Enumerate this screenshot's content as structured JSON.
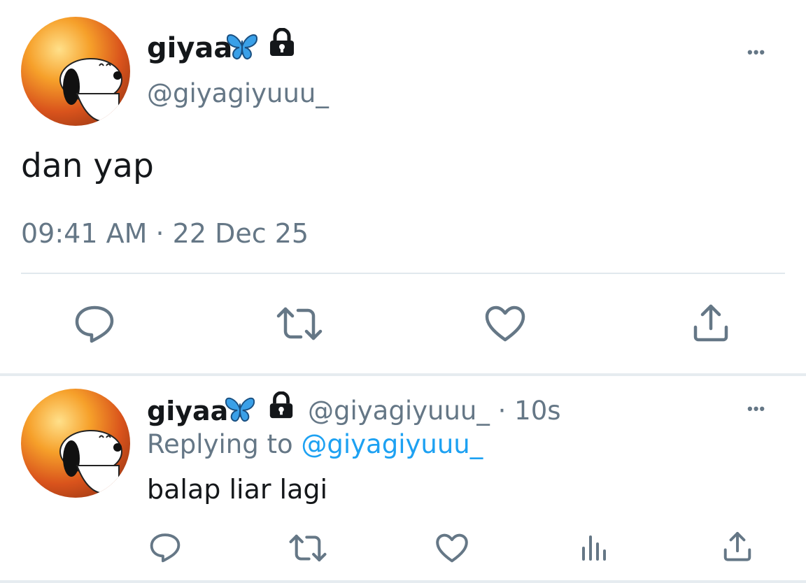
{
  "main_tweet": {
    "display_name": "giyaa",
    "handle": "@giyagiyuuu_",
    "text": "dan yap",
    "timestamp": "09:41 AM",
    "separator": "·",
    "date": "22 Dec 25",
    "more_label": "•••"
  },
  "reply_tweet": {
    "display_name": "giyaa",
    "handle": "@giyagiyuuu_",
    "separator": "·",
    "age": "10s",
    "replying_prefix": "Replying to",
    "replying_handle": "@giyagiyuuu_",
    "text": "balap liar lagi",
    "more_label": "•••"
  },
  "icons": {
    "badge": "butterfly-icon",
    "lock": "lock-icon",
    "reply": "reply-icon",
    "retweet": "retweet-icon",
    "like": "heart-icon",
    "share": "share-icon",
    "analytics": "analytics-icon"
  },
  "colors": {
    "text": "#14171a",
    "secondary": "#657786",
    "link": "#1da1f2",
    "divider": "#e1e8ed",
    "butterfly": "#3aa0e8"
  }
}
